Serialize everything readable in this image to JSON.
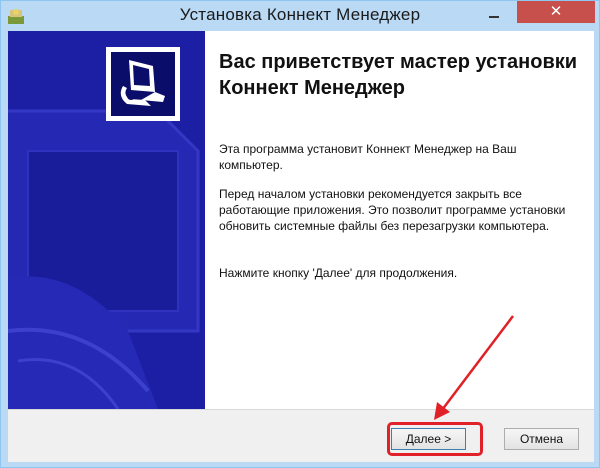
{
  "window": {
    "title": "Установка Коннект Менеджер",
    "close_label": "✕"
  },
  "content": {
    "heading": "Вас приветствует мастер установки Коннект Менеджер",
    "paragraph1": "Эта программа установит Коннект Менеджер на Ваш компьютер.",
    "paragraph2": "Перед началом установки рекомендуется закрыть все работающие приложения. Это позволит программе установки обновить системные файлы без перезагрузки компьютера.",
    "paragraph3": "Нажмите кнопку 'Далее' для продолжения."
  },
  "buttons": {
    "next_label": "Далее >",
    "cancel_label": "Отмена"
  },
  "colors": {
    "sidebar": "#1c1fa3",
    "titlebar": "#b9d9f5",
    "close_button": "#c7504c",
    "annotation": "#e02128"
  }
}
